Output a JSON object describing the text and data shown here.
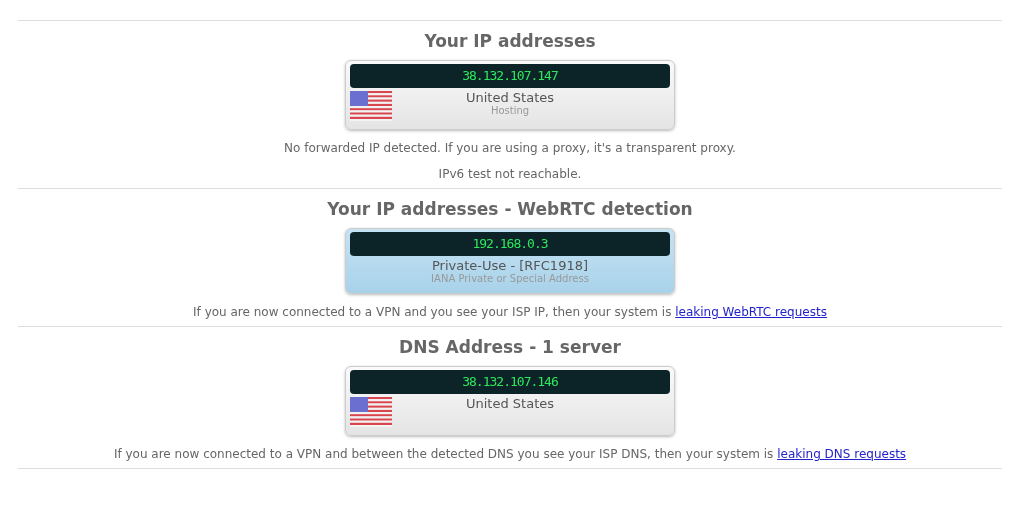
{
  "sections": [
    {
      "title": "Your IP addresses",
      "card": {
        "kind": "country",
        "ip": "38.132.107.147",
        "name": "United States",
        "detail": "Hosting"
      },
      "notes": [
        {
          "text": "No forwarded IP detected. If you are using a proxy, it's a transparent proxy."
        },
        {
          "text": "IPv6 test not reachable."
        }
      ]
    },
    {
      "title": "Your IP addresses - WebRTC detection",
      "card": {
        "kind": "private",
        "ip": "192.168.0.3",
        "name": "Private-Use - [RFC1918]",
        "detail": "IANA Private or Special Address"
      },
      "notes": [
        {
          "text": "If you are now connected to a VPN and you see your ISP IP, then your system is",
          "link": "leaking WebRTC requests"
        }
      ]
    },
    {
      "title": "DNS Address - 1 server",
      "card": {
        "kind": "country",
        "ip": "38.132.107.146",
        "name": "United States"
      },
      "notes": [
        {
          "text": "If you are now connected to a VPN and between the detected DNS you see your ISP DNS, then your system is",
          "link": "leaking DNS requests"
        }
      ]
    }
  ]
}
